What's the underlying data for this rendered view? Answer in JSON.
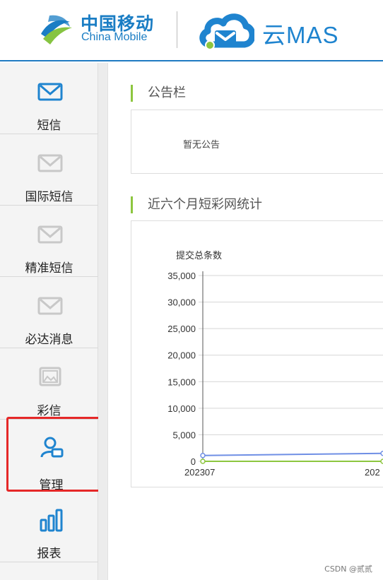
{
  "header": {
    "brand_cn": "中国移动",
    "brand_en": "China Mobile",
    "product": "云MAS",
    "accent_blue": "#1f84cf",
    "accent_green": "#8dc63f"
  },
  "sidebar": {
    "items": [
      {
        "label": "短信",
        "icon": "envelope-icon",
        "active": true
      },
      {
        "label": "国际短信",
        "icon": "envelope-icon",
        "active": false
      },
      {
        "label": "精准短信",
        "icon": "envelope-icon",
        "active": false
      },
      {
        "label": "必达消息",
        "icon": "envelope-icon",
        "active": false
      },
      {
        "label": "彩信",
        "icon": "picture-frame-icon",
        "active": false
      },
      {
        "label": "管理",
        "icon": "user-card-icon",
        "active": true
      },
      {
        "label": "报表",
        "icon": "bar-chart-icon",
        "active": true
      }
    ]
  },
  "main": {
    "notice_title": "公告栏",
    "notice_text": "暂无公告",
    "stats_title": "近六个月短彩网统计"
  },
  "chart_data": {
    "type": "line",
    "ylabel": "提交总条数",
    "ylim": [
      0,
      35000
    ],
    "yticks": [
      "35,000",
      "30,000",
      "25,000",
      "20,000",
      "15,000",
      "10,000",
      "5,000",
      "0"
    ],
    "categories": [
      "202307",
      "202"
    ],
    "series": [
      {
        "name": "",
        "color": "#6f8fe5",
        "values": [
          1100,
          1500
        ]
      },
      {
        "name": "",
        "color": "#8dc63f",
        "values": [
          0,
          0
        ]
      }
    ]
  },
  "footer": {
    "watermark": "CSDN @贰贰"
  }
}
